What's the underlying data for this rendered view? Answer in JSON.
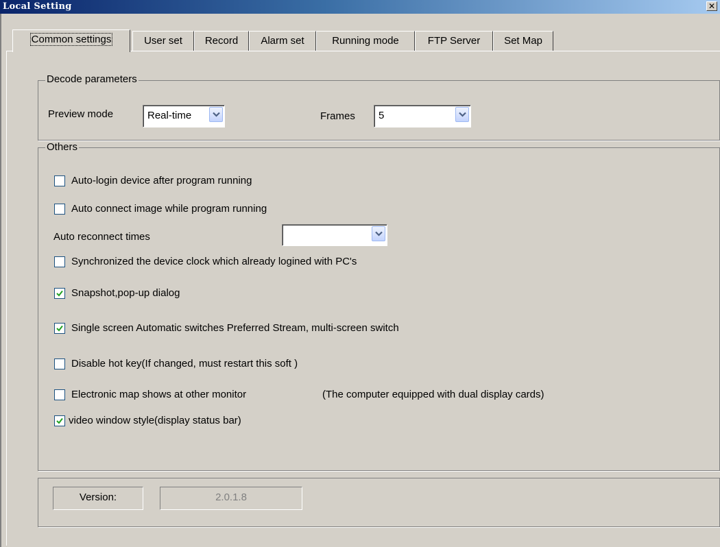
{
  "window": {
    "title": "Local Setting",
    "close_glyph": "✕"
  },
  "tabs": [
    {
      "label": "Common settings",
      "active": true
    },
    {
      "label": "User set"
    },
    {
      "label": "Record"
    },
    {
      "label": "Alarm set"
    },
    {
      "label": "Running mode"
    },
    {
      "label": "FTP Server"
    },
    {
      "label": "Set Map"
    }
  ],
  "decode": {
    "legend": "Decode parameters",
    "preview_label": "Preview mode",
    "preview_value": "Real-time",
    "frames_label": "Frames",
    "frames_value": "5"
  },
  "others": {
    "legend": "Others",
    "auto_login": {
      "label": "Auto-login device  after  program running",
      "checked": false
    },
    "auto_connect": {
      "label": "Auto connect image while program running",
      "checked": false
    },
    "reconnect_label": "Auto reconnect times",
    "reconnect_value": "",
    "sync_clock": {
      "label": "Synchronized the device  clock which already logined with PC's",
      "checked": false
    },
    "snapshot": {
      "label": "Snapshot,pop-up dialog",
      "checked": true
    },
    "single_screen": {
      "label": "Single screen Automatic switches Preferred Stream, multi-screen switch",
      "checked": true
    },
    "hotkey": {
      "label": "Disable hot key(If changed, must restart this soft )",
      "checked": false
    },
    "emap": {
      "label": "Electronic map shows at other monitor",
      "checked": false
    },
    "emap_note": "(The computer equipped with dual display cards)",
    "video_style": {
      "label": "video window style(display status bar)",
      "checked": true
    }
  },
  "version": {
    "label": "Version:",
    "value": "2.0.1.8"
  },
  "colors": {
    "face": "#d4d0c8",
    "titlebar_start": "#0a246a",
    "titlebar_end": "#a6caf0",
    "check": "#21a121"
  }
}
